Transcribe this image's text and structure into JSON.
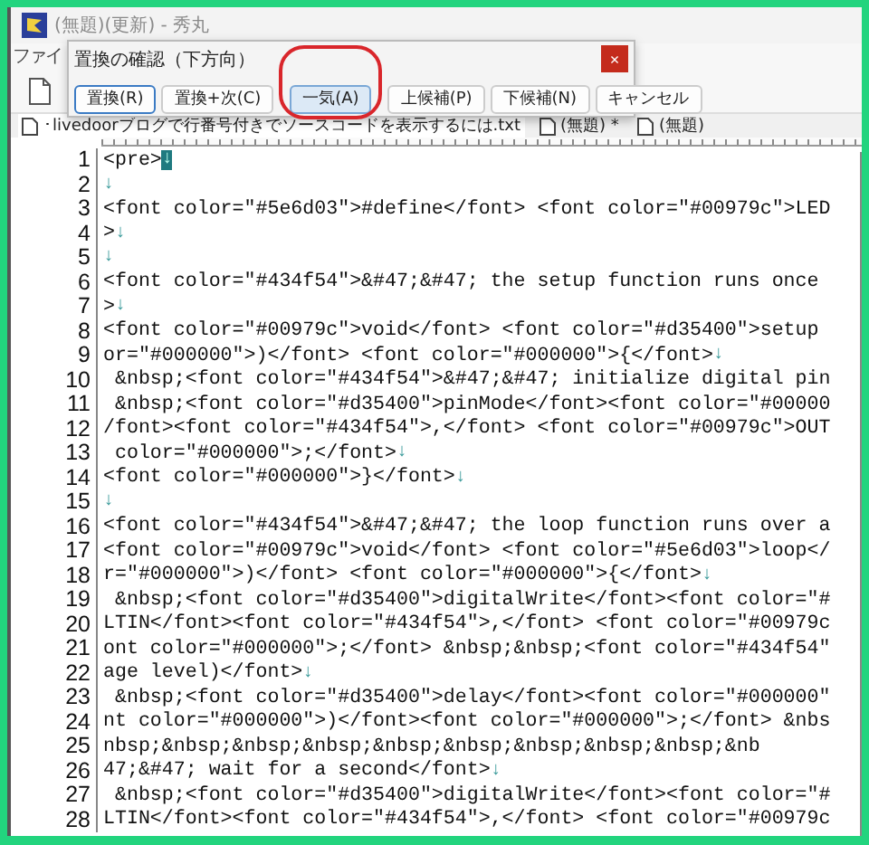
{
  "window": {
    "title": "(無題)(更新) - 秀丸"
  },
  "menu": [
    {
      "label": "ファイ"
    }
  ],
  "tabs": [
    {
      "label": "･livedoorブログで行番号付きでソースコードを表示するには.txt",
      "selected": true
    },
    {
      "label": "(無題) *",
      "selected": false
    },
    {
      "label": "(無題)",
      "selected": false
    }
  ],
  "editor": {
    "lines": [
      {
        "number": "1",
        "text": "<pre>",
        "eol": "↓",
        "cursor": true
      },
      {
        "number": "2",
        "eol": "↓"
      },
      {
        "number": "3",
        "text": "<font color=\"#5e6d03\">#define</font> <font color=\"#00979c\">LED"
      },
      {
        "number": "4",
        "text": ">",
        "eol": "↓"
      },
      {
        "number": "5",
        "eol": "↓"
      },
      {
        "number": "6",
        "text": "<font color=\"#434f54\">&#47;&#47; the setup function runs once"
      },
      {
        "number": "7",
        "text": ">",
        "eol": "↓"
      },
      {
        "number": "8",
        "text": "<font color=\"#00979c\">void</font> <font color=\"#d35400\">setup"
      },
      {
        "number": "9",
        "text": "or=\"#000000\">)</font> <font color=\"#000000\">{</font>",
        "eol": "↓"
      },
      {
        "number": "10",
        "text": " &nbsp;<font color=\"#434f54\">&#47;&#47; initialize digital pin"
      },
      {
        "number": "11",
        "text": " &nbsp;<font color=\"#d35400\">pinMode</font><font color=\"#00000"
      },
      {
        "number": "12",
        "text": "/font><font color=\"#434f54\">,</font> <font color=\"#00979c\">OUT"
      },
      {
        "number": "13",
        "text": " color=\"#000000\">;</font>",
        "eol": "↓"
      },
      {
        "number": "14",
        "text": "<font color=\"#000000\">}</font>",
        "eol": "↓"
      },
      {
        "number": "15",
        "eol": "↓"
      },
      {
        "number": "16",
        "text": "<font color=\"#434f54\">&#47;&#47; the loop function runs over a"
      },
      {
        "number": "17",
        "text": "<font color=\"#00979c\">void</font> <font color=\"#5e6d03\">loop</"
      },
      {
        "number": "18",
        "text": "r=\"#000000\">)</font> <font color=\"#000000\">{</font>",
        "eol": "↓"
      },
      {
        "number": "19",
        "text": " &nbsp;<font color=\"#d35400\">digitalWrite</font><font color=\"#"
      },
      {
        "number": "20",
        "text": "LTIN</font><font color=\"#434f54\">,</font> <font color=\"#00979c"
      },
      {
        "number": "21",
        "text": "ont color=\"#000000\">;</font> &nbsp;&nbsp;<font color=\"#434f54\""
      },
      {
        "number": "22",
        "text": "age level)</font>",
        "eol": "↓"
      },
      {
        "number": "23",
        "text": " &nbsp;<font color=\"#d35400\">delay</font><font color=\"#000000\""
      },
      {
        "number": "24",
        "text": "nt color=\"#000000\">)</font><font color=\"#000000\">;</font> &nbs"
      },
      {
        "number": "25",
        "text": "nbsp;&nbsp;&nbsp;&nbsp;&nbsp;&nbsp;&nbsp;&nbsp;&nbsp;&nb"
      },
      {
        "number": "26",
        "text": "47;&#47; wait for a second</font>",
        "eol": "↓"
      },
      {
        "number": "27",
        "text": " &nbsp;<font color=\"#d35400\">digitalWrite</font><font color=\"#"
      },
      {
        "number": "28",
        "text": "LTIN</font><font color=\"#434f54\">,</font> <font color=\"#00979c"
      }
    ]
  },
  "dialog": {
    "title": "置換の確認（下方向）",
    "close": "×",
    "buttons": [
      {
        "label": "置換(R)",
        "focused": true,
        "circled": false
      },
      {
        "label": "置換+次(C)",
        "focused": false,
        "circled": false
      },
      {
        "label": "一気(A)",
        "focused": false,
        "circled": true
      },
      {
        "label": "上候補(P)",
        "focused": false,
        "circled": false
      },
      {
        "label": "下候補(N)",
        "focused": false,
        "circled": false
      },
      {
        "label": "キャンセル",
        "focused": false,
        "circled": false
      }
    ]
  }
}
